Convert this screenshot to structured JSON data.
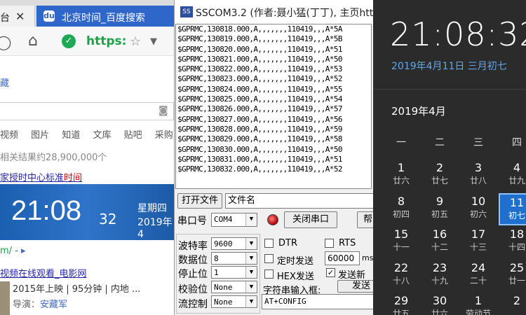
{
  "browser": {
    "tab1_text": "台",
    "tab2_title": "北京时间_百度搜索",
    "tab_close": "✕",
    "url_prefix": "https:",
    "bookmarks_text": "藏",
    "nav_tabs": [
      "视频",
      "图片",
      "知道",
      "文库",
      "贴吧",
      "采购"
    ],
    "result_count": "相关结果约28,900,000个",
    "result_link_text": "家授时中心标准",
    "result_link_highlight": "时间",
    "time_card": {
      "time": "21:08",
      "seconds": "32",
      "weekday": "星期四",
      "date": "2019年4"
    },
    "dot_line": "m/",
    "dot_line_tail": " - ▸",
    "movie_link": "视频在线观看_电影网",
    "movie_meta": "2015年上映 | 95分钟 | 内地 ...",
    "director_label": "导演：",
    "director_name": "安藏军"
  },
  "sscom": {
    "title": "SSCOM3.2 (作者:聂小猛(丁丁), 主页http:",
    "logo": "SS",
    "lines": [
      "$GPRMC,130818.000,A,,,,,,,110419,,,A*5A",
      "$GPRMC,130819.000,A,,,,,,,110419,,,A*5B",
      "$GPRMC,130820.000,A,,,,,,,110419,,,A*51",
      "$GPRMC,130821.000,A,,,,,,,110419,,,A*50",
      "$GPRMC,130822.000,A,,,,,,,110419,,,A*53",
      "$GPRMC,130823.000,A,,,,,,,110419,,,A*52",
      "$GPRMC,130824.000,A,,,,,,,110419,,,A*55",
      "$GPRMC,130825.000,A,,,,,,,110419,,,A*54",
      "$GPRMC,130826.000,A,,,,,,,110419,,,A*57",
      "$GPRMC,130827.000,A,,,,,,,110419,,,A*56",
      "$GPRMC,130828.000,A,,,,,,,110419,,,A*59",
      "$GPRMC,130829.000,A,,,,,,,110419,,,A*58",
      "$GPRMC,130830.000,A,,,,,,,110419,,,A*50",
      "$GPRMC,130831.000,A,,,,,,,110419,,,A*51",
      "$GPRMC,130832.000,A,,,,,,,110419,,,A*52"
    ],
    "open_file_btn": "打开文件",
    "filename_label": "文件名",
    "port_label": "串口号",
    "port_value": "COM4",
    "close_port_btn": "关闭串口",
    "help_btn": "帮",
    "baud_label": "波特率",
    "baud_value": "9600",
    "databits_label": "数据位",
    "databits_value": "8",
    "stopbits_label": "停止位",
    "stopbits_value": "1",
    "parity_label": "校验位",
    "parity_value": "None",
    "flow_label": "流控制",
    "flow_value": "None",
    "dtr_label": "DTR",
    "rts_label": "RTS",
    "timer_label": "定时发送",
    "timer_value": "60000",
    "timer_unit": "ms",
    "hex_send_label": "HEX发送",
    "send_newline_label": "发送新",
    "input_label": "字符串输入框:",
    "send_btn": "发送",
    "input_value": "AT+CONFIG",
    "checked_mark": "✓",
    "dropdown_arrow": "▼"
  },
  "calendar": {
    "clock": "21:08:32",
    "full_date": "2019年4月11日 三月初七",
    "month": "2019年4月",
    "weekdays": [
      "一",
      "二",
      "三",
      "四"
    ],
    "days": [
      {
        "d": "1",
        "l": "廿六"
      },
      {
        "d": "2",
        "l": "廿七"
      },
      {
        "d": "3",
        "l": "廿八"
      },
      {
        "d": "4",
        "l": "廿九"
      },
      {
        "d": "8",
        "l": "初四"
      },
      {
        "d": "9",
        "l": "初五"
      },
      {
        "d": "10",
        "l": "初六"
      },
      {
        "d": "11",
        "l": "初七"
      },
      {
        "d": "15",
        "l": "十一"
      },
      {
        "d": "16",
        "l": "十二"
      },
      {
        "d": "17",
        "l": "十三"
      },
      {
        "d": "18",
        "l": "十四"
      },
      {
        "d": "22",
        "l": "十八"
      },
      {
        "d": "23",
        "l": "十九"
      },
      {
        "d": "24",
        "l": "二十"
      },
      {
        "d": "25",
        "l": "廿一"
      },
      {
        "d": "29",
        "l": "廿五"
      },
      {
        "d": "30",
        "l": "廿六"
      },
      {
        "d": "1",
        "l": "劳动节"
      },
      {
        "d": "2",
        "l": ""
      }
    ],
    "selected_day": "11",
    "accent": "#1f6fcf"
  }
}
